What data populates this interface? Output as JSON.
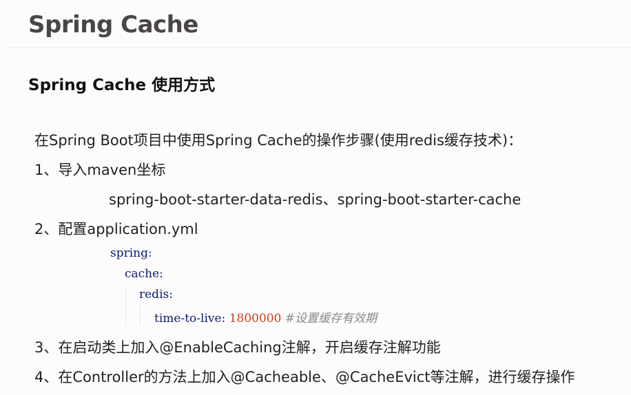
{
  "title": "Spring Cache",
  "subtitle": "Spring Cache 使用方式",
  "intro": "在Spring Boot项目中使用Spring Cache的操作步骤(使用redis缓存技术)：",
  "steps": [
    "1、导入maven坐标",
    "spring-boot-starter-data-redis、spring-boot-starter-cache",
    "2、配置application.yml",
    "3、在启动类上加入@EnableCaching注解，开启缓存注解功能",
    "4、在Controller的方法上加入@Cacheable、@CacheEvict等注解，进行缓存操作"
  ],
  "yaml": {
    "l1": "spring:",
    "l2": "cache:",
    "l3": "redis:",
    "key": "time-to-live:",
    "value": "1800000",
    "comment": "#设置缓存有效期"
  }
}
